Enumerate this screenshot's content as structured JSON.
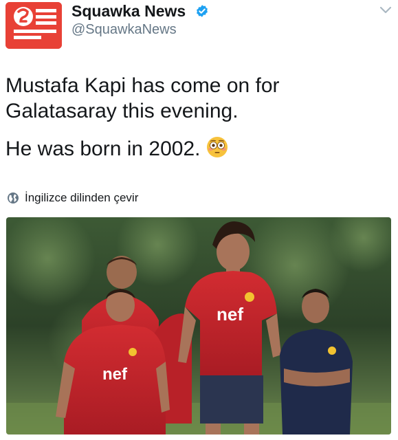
{
  "tweet": {
    "author": {
      "display_name": "Squawka News",
      "handle": "@SquawkaNews",
      "verified": true,
      "avatar_icon": "squawka-logo-icon",
      "brand_color": "#e84136"
    },
    "text_lines": [
      "Mustafa Kapi has come on for Galatasaray this evening.",
      "He was born in 2002."
    ],
    "emoji": "flushed-face-icon",
    "translate_label": "İngilizce dilinden çevir",
    "translate_icon": "globe-icon",
    "menu_icon": "chevron-down-icon",
    "verified_icon": "verified-badge-icon",
    "verified_color": "#1da1f2",
    "media": {
      "type": "photo",
      "jersey_text": "nef",
      "colors": {
        "jersey_red": "#c8222b",
        "foliage": "#2f4a2e",
        "grass": "#4b7a3c",
        "navy": "#1f2a4a"
      }
    }
  }
}
